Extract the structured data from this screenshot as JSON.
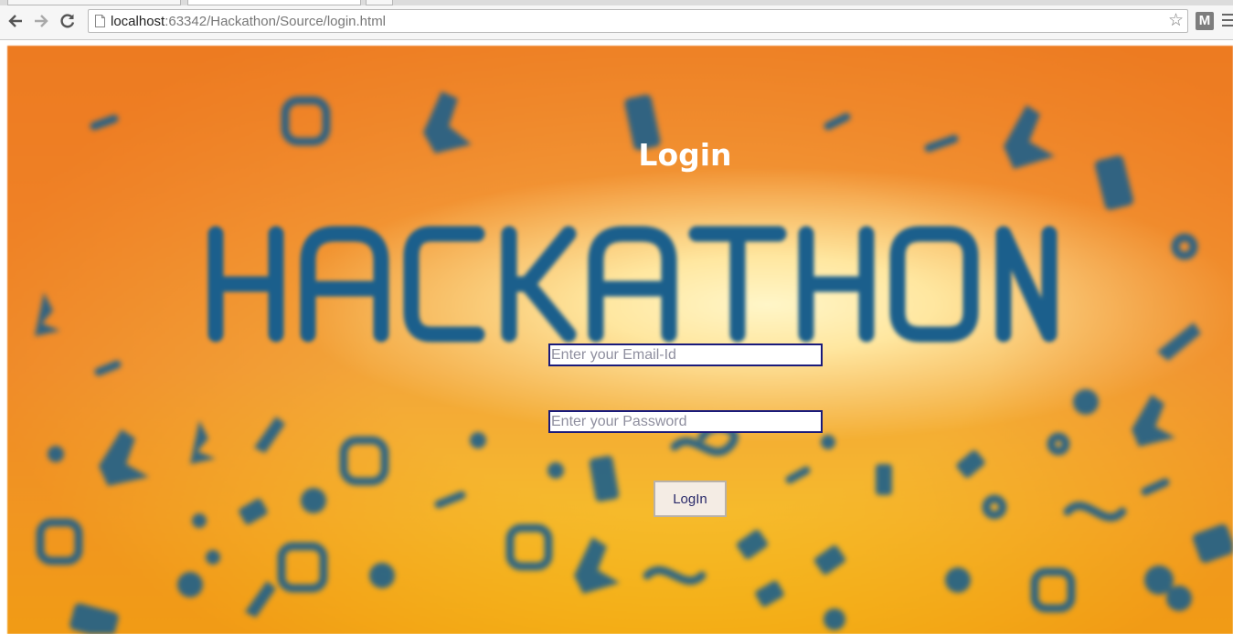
{
  "browser": {
    "url_host": "localhost",
    "url_rest": ":63342/Hackathon/Source/login.html",
    "extension_label": "M"
  },
  "page": {
    "heading": "Login",
    "banner_text": "HACKATHON",
    "email_placeholder": "Enter your Email-Id",
    "password_placeholder": "Enter your Password",
    "login_button": "LogIn"
  },
  "colors": {
    "banner_text": "#1b5f8c",
    "background_top": "#ef8a2c",
    "background_bottom": "#f7c516",
    "field_border": "#1a1a7a"
  },
  "icons": [
    "back-arrow-icon",
    "forward-arrow-icon",
    "reload-icon",
    "page-icon",
    "bookmark-star-icon",
    "menu-icon"
  ]
}
